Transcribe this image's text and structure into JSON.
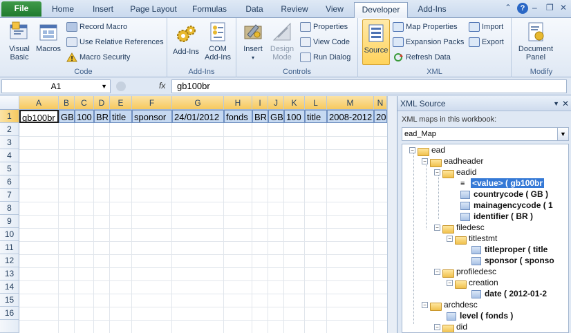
{
  "tabs": [
    "File",
    "Home",
    "Insert",
    "Page Layout",
    "Formulas",
    "Data",
    "Review",
    "View",
    "Developer",
    "Add-Ins"
  ],
  "active_tab": "Developer",
  "ribbon": {
    "code": {
      "label": "Code",
      "visual_basic": "Visual Basic",
      "macros": "Macros",
      "record_macro": "Record Macro",
      "use_relative": "Use Relative References",
      "macro_security": "Macro Security"
    },
    "addins": {
      "label": "Add-Ins",
      "addins": "Add-Ins",
      "com_addins": "COM Add-Ins"
    },
    "controls": {
      "label": "Controls",
      "insert": "Insert",
      "design_mode": "Design Mode",
      "properties": "Properties",
      "view_code": "View Code",
      "run_dialog": "Run Dialog"
    },
    "xml": {
      "label": "XML",
      "source": "Source",
      "map_properties": "Map Properties",
      "expansion_packs": "Expansion Packs",
      "refresh_data": "Refresh Data",
      "import": "Import",
      "export": "Export"
    },
    "modify": {
      "label": "Modify",
      "document_panel": "Document Panel"
    }
  },
  "formula_bar": {
    "name_box": "A1",
    "fx": "fx",
    "value": "gb100br"
  },
  "grid": {
    "columns": [
      "A",
      "B",
      "C",
      "D",
      "E",
      "F",
      "G",
      "H",
      "I",
      "J",
      "K",
      "L",
      "M",
      "N"
    ],
    "rows": [
      "1",
      "2",
      "3",
      "4",
      "5",
      "6",
      "7",
      "8",
      "9",
      "10",
      "11",
      "12",
      "13",
      "14",
      "15",
      "16"
    ],
    "row1": [
      "gb100br",
      "GB",
      "100",
      "BR",
      "title",
      "sponsor",
      "24/01/2012",
      "fonds",
      "BR",
      "GB",
      "100",
      "title",
      "2008-2012",
      "20"
    ]
  },
  "xml_pane": {
    "title": "XML Source",
    "maps_label": "XML maps in this workbook:",
    "selected_map": "ead_Map",
    "tree": [
      {
        "label": "ead",
        "type": "folder"
      },
      {
        "label": "eadheader",
        "type": "folder"
      },
      {
        "label": "eadid",
        "type": "folder"
      },
      {
        "label": "<value> ( gb100br",
        "type": "value"
      },
      {
        "label": "countrycode ( GB )",
        "type": "elem"
      },
      {
        "label": "mainagencycode ( 1",
        "type": "elem"
      },
      {
        "label": "identifier ( BR )",
        "type": "elem"
      },
      {
        "label": "filedesc",
        "type": "folder"
      },
      {
        "label": "titlestmt",
        "type": "folder"
      },
      {
        "label": "titleproper ( title",
        "type": "elem"
      },
      {
        "label": "sponsor ( sponso",
        "type": "elem"
      },
      {
        "label": "profiledesc",
        "type": "folder"
      },
      {
        "label": "creation",
        "type": "folder"
      },
      {
        "label": "date ( 2012-01-2",
        "type": "elem"
      },
      {
        "label": "archdesc",
        "type": "folder"
      },
      {
        "label": "level ( fonds )",
        "type": "elem"
      },
      {
        "label": "did",
        "type": "folder"
      }
    ]
  }
}
